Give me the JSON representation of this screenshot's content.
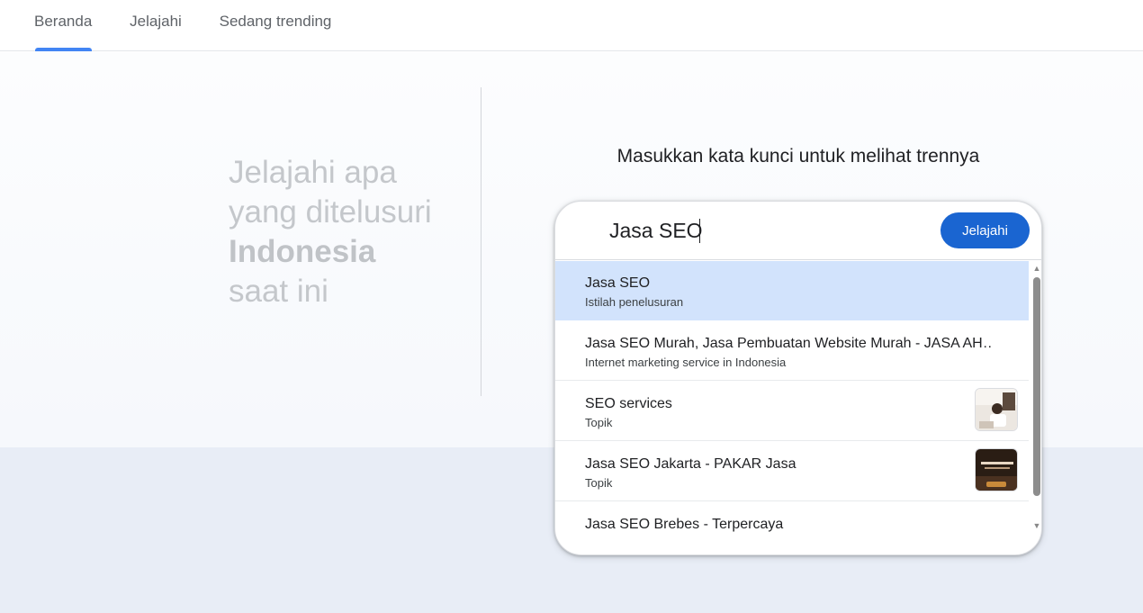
{
  "nav": {
    "tabs": [
      {
        "label": "Beranda",
        "active": true
      },
      {
        "label": "Jelajahi",
        "active": false
      },
      {
        "label": "Sedang trending",
        "active": false
      }
    ],
    "accent_color": "#4285f4"
  },
  "hero": {
    "tagline_line1": "Jelajahi apa",
    "tagline_line2": "yang ditelusuri",
    "tagline_country": "Indonesia",
    "tagline_line4": "saat ini"
  },
  "search": {
    "prompt": "Masukkan kata kunci untuk melihat trennya",
    "query": "Jasa SEO",
    "button_label": "Jelajahi",
    "button_color": "#1a65d1"
  },
  "suggestions": [
    {
      "title": "Jasa SEO",
      "subtitle": "Istilah penelusuran",
      "selected": true,
      "thumbnail": null
    },
    {
      "title": "Jasa SEO Murah, Jasa Pembuatan Website Murah - JASA AH…",
      "subtitle": "Internet marketing service in Indonesia",
      "selected": false,
      "thumbnail": null
    },
    {
      "title": "SEO services",
      "subtitle": "Topik",
      "selected": false,
      "thumbnail": "seo-services-photo"
    },
    {
      "title": "Jasa SEO Jakarta - PAKAR Jasa",
      "subtitle": "Topik",
      "selected": false,
      "thumbnail": "pakar-jasa-photo"
    },
    {
      "title": "Jasa SEO Brebes - Terpercaya",
      "subtitle": "",
      "selected": false,
      "thumbnail": null
    }
  ]
}
